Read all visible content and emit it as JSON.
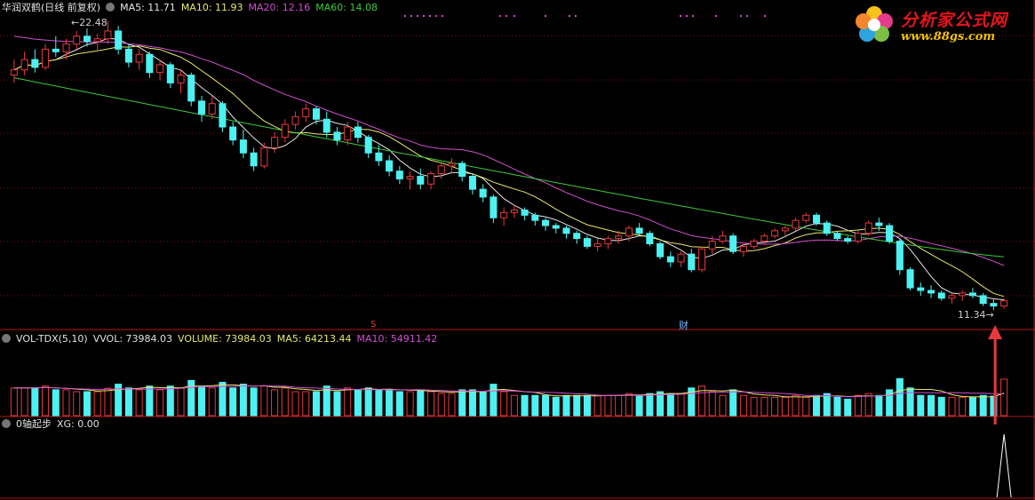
{
  "header_main": {
    "stock_name": "华润双鹤(日线 前复权)",
    "ma5": "MA5: 11.71",
    "ma10": "MA10: 11.93",
    "ma20": "MA20: 12.16",
    "ma60": "MA60: 14.08"
  },
  "header_vol": {
    "name": "VOL-TDX(5,10)",
    "vvol": "VVOL: 73984.03",
    "volume": "VOLUME: 73984.03",
    "ma5": "MA5: 64213.44",
    "ma10": "MA10: 54911.42"
  },
  "header_ind": {
    "name": "0轴起步",
    "xg": "XG: 0.00"
  },
  "markers": {
    "high_label": "22.48",
    "low_label": "11.34",
    "event_s": "S",
    "event_cai": "财"
  },
  "logo": {
    "brand": "分析家公式网",
    "url": "www.88gs.com"
  },
  "colors": {
    "up": "#e8393c",
    "down": "#4df1f1",
    "ma5": "#e6e6e6",
    "ma10": "#e8e86a",
    "ma20": "#d04fd0",
    "ma60": "#3cc93c",
    "arrow": "#e8393c",
    "grid": "#7a1515"
  },
  "chart_data": {
    "type": "candlestick",
    "price_high": 22.48,
    "price_low": 11.34,
    "candles_ohlc": [
      [
        20.4,
        21.0,
        20.1,
        20.6
      ],
      [
        20.6,
        21.3,
        20.4,
        21.0
      ],
      [
        21.0,
        21.4,
        20.5,
        20.7
      ],
      [
        20.7,
        21.6,
        20.6,
        21.4
      ],
      [
        21.4,
        21.9,
        21.1,
        21.3
      ],
      [
        21.3,
        21.8,
        21.0,
        21.6
      ],
      [
        21.6,
        22.1,
        21.4,
        21.9
      ],
      [
        21.9,
        22.2,
        21.5,
        21.7
      ],
      [
        21.7,
        22.0,
        21.3,
        21.8
      ],
      [
        21.8,
        22.48,
        21.6,
        22.1
      ],
      [
        22.1,
        22.3,
        21.2,
        21.4
      ],
      [
        21.4,
        21.6,
        20.7,
        20.9
      ],
      [
        20.9,
        21.4,
        20.6,
        21.2
      ],
      [
        21.2,
        21.3,
        20.3,
        20.5
      ],
      [
        20.5,
        21.0,
        20.2,
        20.8
      ],
      [
        20.8,
        20.9,
        19.9,
        20.1
      ],
      [
        20.1,
        20.6,
        19.7,
        20.4
      ],
      [
        20.4,
        20.5,
        19.2,
        19.4
      ],
      [
        19.4,
        19.6,
        18.6,
        18.9
      ],
      [
        18.9,
        19.6,
        18.7,
        19.3
      ],
      [
        19.3,
        19.4,
        18.2,
        18.4
      ],
      [
        18.4,
        18.6,
        17.7,
        17.9
      ],
      [
        17.9,
        18.3,
        17.2,
        17.4
      ],
      [
        17.4,
        17.6,
        16.7,
        16.9
      ],
      [
        16.9,
        17.8,
        16.8,
        17.6
      ],
      [
        17.6,
        18.2,
        17.4,
        18.0
      ],
      [
        18.0,
        18.7,
        17.8,
        18.5
      ],
      [
        18.5,
        19.0,
        18.3,
        18.8
      ],
      [
        18.8,
        19.3,
        18.6,
        19.1
      ],
      [
        19.1,
        19.2,
        18.5,
        18.7
      ],
      [
        18.7,
        19.0,
        18.0,
        18.2
      ],
      [
        18.2,
        18.4,
        17.7,
        17.9
      ],
      [
        17.9,
        18.6,
        17.7,
        18.4
      ],
      [
        18.4,
        18.6,
        17.8,
        18.0
      ],
      [
        18.0,
        18.1,
        17.2,
        17.4
      ],
      [
        17.4,
        17.7,
        16.9,
        17.1
      ],
      [
        17.1,
        17.3,
        16.5,
        16.7
      ],
      [
        16.7,
        16.9,
        16.2,
        16.4
      ],
      [
        16.4,
        16.7,
        16.0,
        16.5
      ],
      [
        16.5,
        16.8,
        16.0,
        16.2
      ],
      [
        16.2,
        16.7,
        16.0,
        16.6
      ],
      [
        16.6,
        17.0,
        16.4,
        16.9
      ],
      [
        16.9,
        17.2,
        16.6,
        17.0
      ],
      [
        17.0,
        17.1,
        16.3,
        16.5
      ],
      [
        16.5,
        16.6,
        15.8,
        16.0
      ],
      [
        16.0,
        16.2,
        15.5,
        15.7
      ],
      [
        15.7,
        15.8,
        14.7,
        14.9
      ],
      [
        14.9,
        15.3,
        14.6,
        15.1
      ],
      [
        15.1,
        15.4,
        14.9,
        15.2
      ],
      [
        15.2,
        15.3,
        14.8,
        15.0
      ],
      [
        15.0,
        15.1,
        14.6,
        14.8
      ],
      [
        14.8,
        14.9,
        14.4,
        14.6
      ],
      [
        14.6,
        14.7,
        14.3,
        14.5
      ],
      [
        14.5,
        14.6,
        14.1,
        14.3
      ],
      [
        14.3,
        14.4,
        13.9,
        14.1
      ],
      [
        14.1,
        14.2,
        13.7,
        13.8
      ],
      [
        13.8,
        14.1,
        13.6,
        13.9
      ],
      [
        13.9,
        14.2,
        13.7,
        14.1
      ],
      [
        14.1,
        14.4,
        13.9,
        14.2
      ],
      [
        14.2,
        14.6,
        14.0,
        14.5
      ],
      [
        14.5,
        14.7,
        14.2,
        14.3
      ],
      [
        14.3,
        14.4,
        13.8,
        13.9
      ],
      [
        13.9,
        14.0,
        13.3,
        13.4
      ],
      [
        13.4,
        13.6,
        13.0,
        13.2
      ],
      [
        13.2,
        13.6,
        13.0,
        13.5
      ],
      [
        13.5,
        13.7,
        12.8,
        12.9
      ],
      [
        12.9,
        13.8,
        12.8,
        13.7
      ],
      [
        13.7,
        14.2,
        13.5,
        14.0
      ],
      [
        14.0,
        14.4,
        13.9,
        14.2
      ],
      [
        14.2,
        14.3,
        13.5,
        13.6
      ],
      [
        13.6,
        13.9,
        13.4,
        13.8
      ],
      [
        13.8,
        14.1,
        13.7,
        14.0
      ],
      [
        14.0,
        14.3,
        13.9,
        14.2
      ],
      [
        14.2,
        14.5,
        14.1,
        14.4
      ],
      [
        14.4,
        14.6,
        14.2,
        14.5
      ],
      [
        14.5,
        14.9,
        14.4,
        14.8
      ],
      [
        14.8,
        15.1,
        14.7,
        15.0
      ],
      [
        15.0,
        15.1,
        14.6,
        14.7
      ],
      [
        14.7,
        14.8,
        14.2,
        14.3
      ],
      [
        14.3,
        14.4,
        14.0,
        14.1
      ],
      [
        14.1,
        14.2,
        13.9,
        14.0
      ],
      [
        14.0,
        14.4,
        13.9,
        14.3
      ],
      [
        14.3,
        14.8,
        14.2,
        14.7
      ],
      [
        14.7,
        14.9,
        14.4,
        14.6
      ],
      [
        14.6,
        14.7,
        13.9,
        14.0
      ],
      [
        14.0,
        14.1,
        12.7,
        12.9
      ],
      [
        12.9,
        13.0,
        12.1,
        12.2
      ],
      [
        12.2,
        12.4,
        11.9,
        12.1
      ],
      [
        12.1,
        12.3,
        11.8,
        12.0
      ],
      [
        12.0,
        12.1,
        11.7,
        11.8
      ],
      [
        11.8,
        12.0,
        11.6,
        11.9
      ],
      [
        11.9,
        12.1,
        11.7,
        12.0
      ],
      [
        12.0,
        12.2,
        11.8,
        11.9
      ],
      [
        11.9,
        12.0,
        11.5,
        11.6
      ],
      [
        11.6,
        11.8,
        11.34,
        11.5
      ],
      [
        11.5,
        11.8,
        11.4,
        11.7
      ]
    ],
    "ma_ranges": {
      "ma60": [
        20.3,
        13.4
      ],
      "ma20_start": 21.9
    },
    "volume": {
      "last": 73984.03,
      "ma5": 64213.44,
      "ma10": 54911.42
    },
    "xg": {
      "value": 0.0,
      "spike_at_last": true
    }
  }
}
